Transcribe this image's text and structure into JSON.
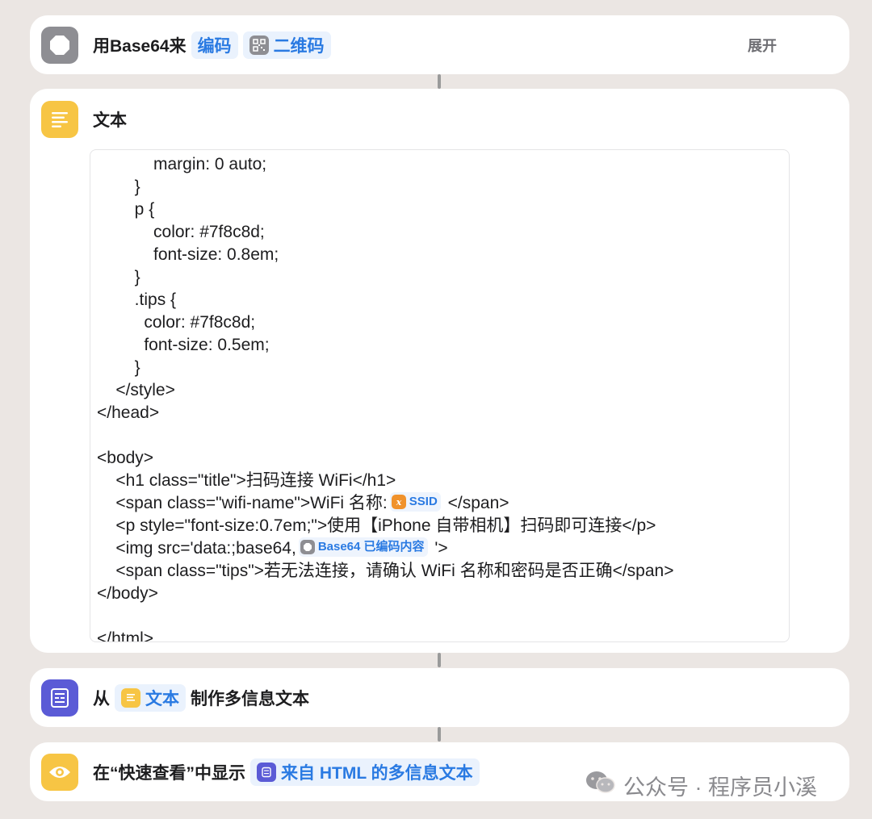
{
  "base64_card": {
    "action_prefix": "用Base64来",
    "mode_token": "编码",
    "input_token": "二维码",
    "expand_label": "展开"
  },
  "text_card": {
    "title": "文本",
    "code_lines": [
      {
        "text": "            margin: 0 auto;"
      },
      {
        "text": "        }"
      },
      {
        "text": "        p {"
      },
      {
        "text": "            color: #7f8c8d;"
      },
      {
        "text": "            font-size: 0.8em;"
      },
      {
        "text": "        }"
      },
      {
        "text": "        .tips {"
      },
      {
        "text": "          color: #7f8c8d;"
      },
      {
        "text": "          font-size: 0.5em;"
      },
      {
        "text": "        }"
      },
      {
        "text": "    </style>"
      },
      {
        "text": "</head>"
      },
      {
        "text": ""
      },
      {
        "text": "<body>"
      },
      {
        "text": "    <h1 class=\"title\">扫码连接 WiFi</h1>"
      },
      {
        "text": "    <span class=\"wifi-name\">WiFi 名称:",
        "var_label": "SSID",
        "var_icon": "variable-x-icon",
        "var_color": "#f0922b",
        "after": " </span>"
      },
      {
        "text": "    <p style=\"font-size:0.7em;\">使用【iPhone 自带相机】扫码即可连接</p>"
      },
      {
        "text": "    <img src='data:;base64,",
        "var_label": "Base64 已编码内容",
        "var_icon": "base64-octagon-icon",
        "var_color": "#8e8e93",
        "after": " '>"
      },
      {
        "text": "    <span class=\"tips\">若无法连接，请确认 WiFi 名称和密码是否正确</span>"
      },
      {
        "text": "</body>"
      },
      {
        "text": ""
      },
      {
        "text": "</html>"
      }
    ]
  },
  "rich_text_card": {
    "prefix": "从",
    "input_token": "文本",
    "suffix": "制作多信息文本"
  },
  "quicklook_card": {
    "title": "在“快速查看”中显示",
    "input_token": "来自 HTML 的多信息文本"
  },
  "watermark": {
    "text": "公众号 · 程序员小溪"
  },
  "colors": {
    "background": "#ebe6e3",
    "token_blue": "#2a7ae2",
    "text_action_yellow": "#f7c544",
    "rich_text_purple": "#5b5bd6",
    "base64_gray": "#8e8e93"
  }
}
